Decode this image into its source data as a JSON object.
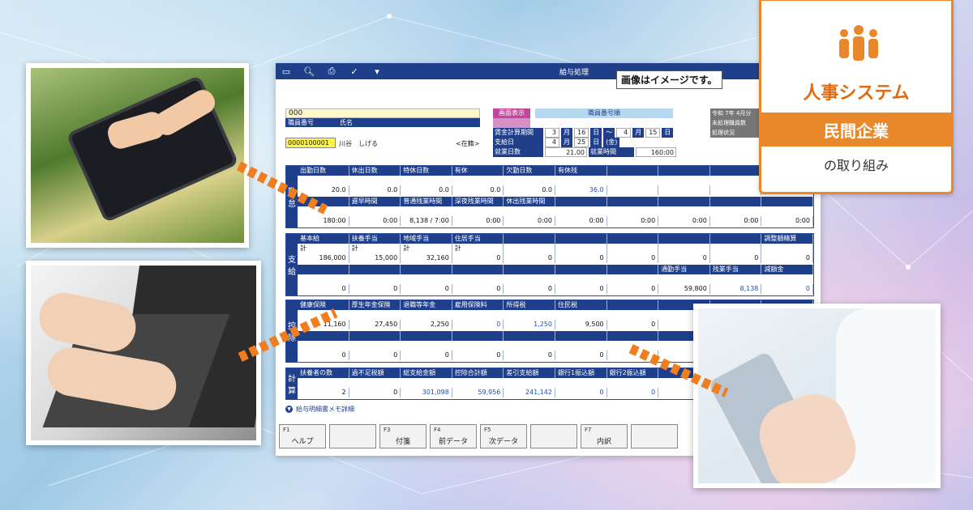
{
  "app": {
    "title": "給与処理",
    "note": "画像はイメージです。",
    "header": {
      "code": "000",
      "employee_no_label": "職員番号",
      "name_label": "氏名",
      "employee_no": "0000100001",
      "name": "川谷　しげる",
      "status": "<在籍>",
      "screen_label": "画面表示",
      "order_label": "職員番号順",
      "calc_period_label": "賃金計算期間",
      "calc_period": [
        "3",
        "月",
        "16",
        "日",
        "～",
        "4",
        "月",
        "15",
        "日"
      ],
      "pay_date_label": "支給日",
      "pay_date": [
        "4",
        "月",
        "25",
        "日",
        "(金)"
      ],
      "work_days_label": "就業日数",
      "work_days": "21.00",
      "work_hours_label": "就業時間",
      "work_hours": "160:00",
      "era": "令和 7年 4月分",
      "unprocessed_label": "未処理職員数",
      "status_label": "処理状況"
    },
    "attendance": {
      "label": "勤怠",
      "h1": [
        "出勤日数",
        "休出日数",
        "特休日数",
        "有休",
        "欠勤日数",
        "有休残",
        "",
        "",
        "",
        ""
      ],
      "v1": [
        "20.0",
        "0.0",
        "0.0",
        "0.0",
        "0.0",
        "36.0",
        "",
        "",
        "",
        ""
      ],
      "h2": [
        "",
        "遅早時間",
        "普通残業時間",
        "深夜残業時間",
        "休出残業時間",
        "",
        "",
        "",
        "",
        ""
      ],
      "v2": [
        "180:00",
        "0:00",
        "8,138 / 7:00",
        "0:00",
        "0:00",
        "0:00",
        "0:00",
        "0:00",
        "0:00",
        "0:00"
      ]
    },
    "payment": {
      "label": "支給",
      "h1": [
        "基本給",
        "扶養手当",
        "地域手当",
        "住居手当",
        "",
        "",
        "",
        "",
        "",
        "調整額精算"
      ],
      "s1": [
        "計",
        "計",
        "計",
        "計",
        "",
        "",
        "",
        "",
        "",
        ""
      ],
      "v1": [
        "186,000",
        "15,000",
        "32,160",
        "0",
        "0",
        "0",
        "0",
        "0",
        "0",
        "0"
      ],
      "h2": [
        "",
        "",
        "",
        "",
        "",
        "",
        "",
        "通勤手当",
        "残業手当",
        "減額金"
      ],
      "v2": [
        "0",
        "0",
        "0",
        "0",
        "0",
        "0",
        "0",
        "59,800",
        "8,138",
        "0"
      ]
    },
    "deduction": {
      "label": "控除",
      "h1": [
        "健康保険",
        "厚生年金保険",
        "退職等年金",
        "雇用保険料",
        "所得税",
        "住民税",
        "",
        "",
        "",
        ""
      ],
      "v1": [
        "11,160",
        "27,450",
        "2,250",
        "0",
        "1,250",
        "9,500",
        "0",
        "",
        "",
        ""
      ],
      "v2": [
        "0",
        "0",
        "0",
        "0",
        "0",
        "0",
        "",
        "",
        "",
        ""
      ]
    },
    "totals": {
      "label": "計算",
      "h1": [
        "扶養者の数",
        "過不足税額",
        "総支給金額",
        "控除合計額",
        "差引支給額",
        "銀行1振込額",
        "銀行2振込額",
        "",
        "",
        ""
      ],
      "v1": [
        "2",
        "0",
        "301,098",
        "59,956",
        "241,142",
        "0",
        "0",
        "",
        "",
        ""
      ]
    },
    "memo": "給与明細書メモ詳細",
    "fkeys": [
      {
        "n": "F1",
        "l": "ヘルプ"
      },
      {
        "n": "",
        "l": ""
      },
      {
        "n": "F3",
        "l": "付箋"
      },
      {
        "n": "F4",
        "l": "前データ"
      },
      {
        "n": "F5",
        "l": "次データ"
      },
      {
        "n": "",
        "l": ""
      },
      {
        "n": "F7",
        "l": "内訳"
      },
      {
        "n": "",
        "l": ""
      }
    ]
  },
  "badge": {
    "title": "人事システム",
    "sub": "民間企業",
    "tail": "の取り組み",
    "color": "#e8882a"
  }
}
